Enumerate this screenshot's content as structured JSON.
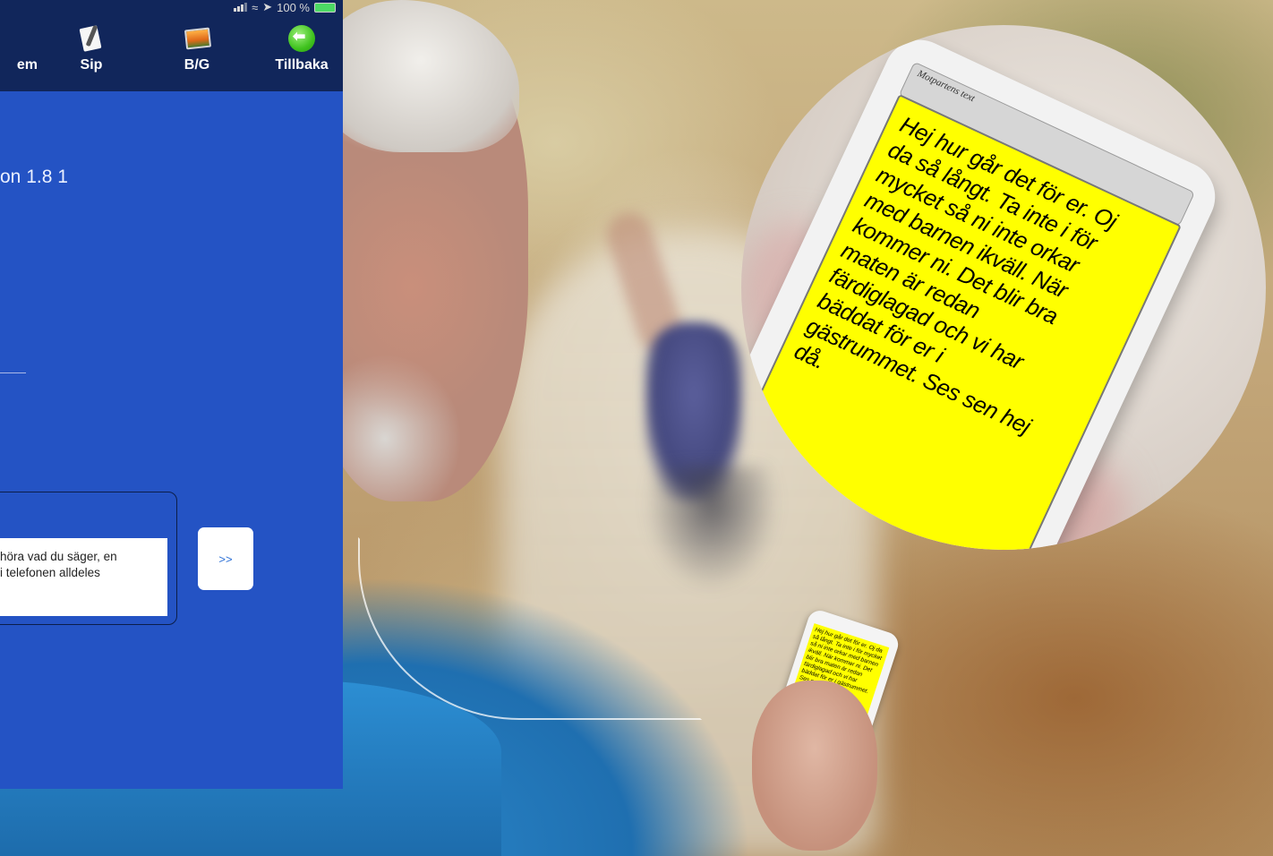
{
  "status_bar": {
    "battery": "100 %"
  },
  "nav": {
    "items": [
      {
        "label": "em",
        "icon": "system-icon"
      },
      {
        "label": "Sip",
        "icon": "note-pen-icon"
      },
      {
        "label": "B/G",
        "icon": "image-icon"
      },
      {
        "label": "Tillbaka",
        "icon": "back-arrow-icon"
      }
    ]
  },
  "main": {
    "version_text": "on 1.8 1",
    "message_text_line1": "höra vad du säger, en",
    "message_text_line2": "i telefonen alldeles",
    "send_label": ">>"
  },
  "zoom_phone": {
    "header_label": "Motpartens text",
    "message_lines": [
      "Hej hur går det för er.  Oj",
      "da så långt.  Ta inte i för",
      "mycket så ni inte orkar",
      "med barnen ikväll. När",
      "kommer ni. Det blir bra",
      "maten är redan",
      "färdiglagad och vi har",
      "bäddat för er i",
      "gästrummet. Ses sen hej",
      "då."
    ]
  },
  "small_phone": {
    "message_text": "Hej hur går det för er.  Oj da så långt.  Ta inte i för mycket så ni inte orkar med barnen ikväll. När kommer ni. Det blir bra maten är redan färdiglagad och vi har bäddat för er i gästrummet. Ses sen hej då."
  },
  "colors": {
    "app_background": "#2453c4",
    "top_bar": "#11265b",
    "text_highlight": "#ffff00",
    "battery": "#4cd964"
  }
}
